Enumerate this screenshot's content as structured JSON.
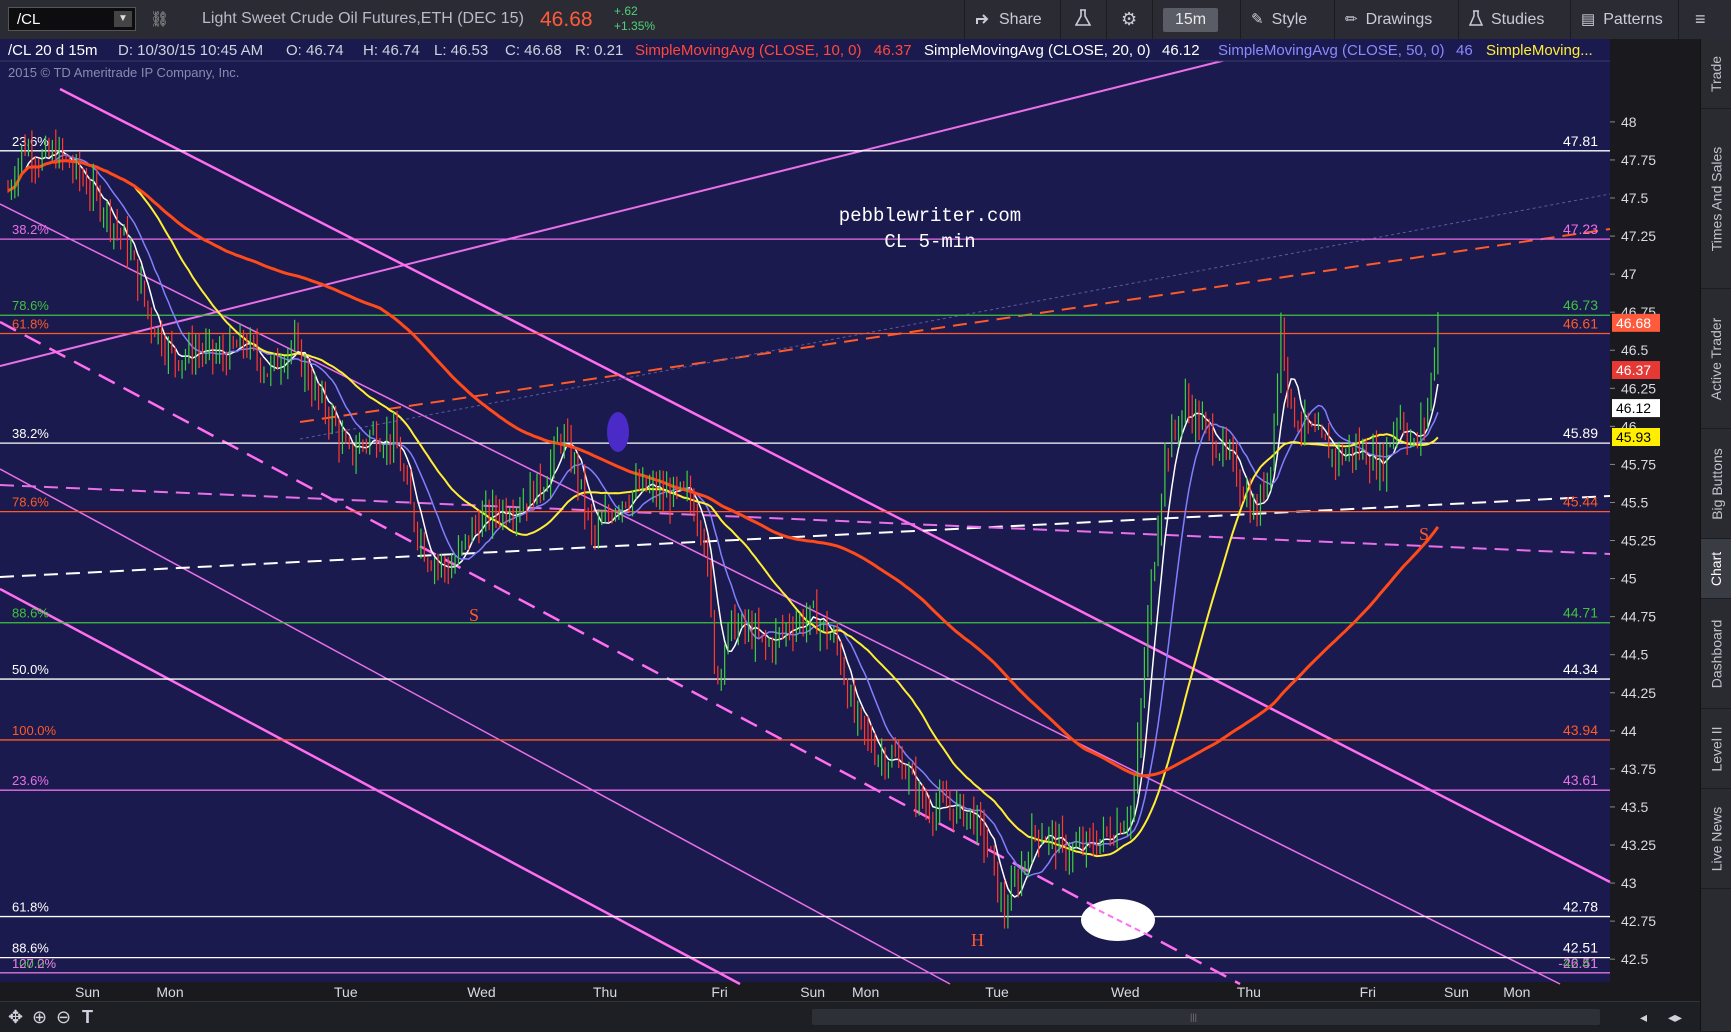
{
  "toolbar": {
    "symbol": "/CL",
    "dropdown_glyph": "▼",
    "link_glyph": "⛓",
    "description": "Light Sweet Crude Oil Futures,ETH (DEC 15)",
    "last_price": "46.68",
    "change": "+.62",
    "change_pct": "+1.35%",
    "share": "Share",
    "timeframe": "15m",
    "style": "Style",
    "drawings": "Drawings",
    "studies": "Studies",
    "patterns": "Patterns",
    "icons": {
      "share": "share-icon",
      "flask": "flask-icon",
      "gear": "gear-icon",
      "menu": "menu-icon"
    }
  },
  "header": {
    "symbol_info": "/CL 20 d 15m",
    "date": "D: 10/30/15 10:45 AM",
    "open": "O: 46.74",
    "high": "H: 46.74",
    "low": "L: 46.53",
    "close": "C: 46.68",
    "range": "R: 0.21",
    "sma10_label": "SimpleMovingAvg (CLOSE, 10, 0)",
    "sma10_value": "46.37",
    "sma20_label": "SimpleMovingAvg (CLOSE, 20, 0)",
    "sma20_value": "46.12",
    "sma50_label": "SimpleMovingAvg (CLOSE, 50, 0)",
    "sma50_value": "46",
    "sma_more": "SimpleMoving...",
    "copyright": "2015 © TD Ameritrade IP Company, Inc."
  },
  "watermark": {
    "line1": "pebblewriter.com",
    "line2": "CL 5-min"
  },
  "chart_data": {
    "type": "candlestick",
    "symbol": "/CL",
    "aggregation": "15m",
    "y_axis_ticks": [
      48,
      47.75,
      47.5,
      47.25,
      47,
      46.75,
      46.5,
      46.25,
      46,
      45.75,
      45.5,
      45.25,
      45,
      44.75,
      44.5,
      44.25,
      44,
      43.75,
      43.5,
      43.25,
      43,
      42.75,
      42.5
    ],
    "ylim": [
      42.35,
      48.4
    ],
    "x_axis_labels": [
      "Sun",
      "Mon",
      "Tue",
      "Wed",
      "Thu",
      "Fri",
      "Sun",
      "Mon",
      "Tue",
      "Wed",
      "Thu",
      "Fri",
      "Sun",
      "Mon"
    ],
    "x_axis_label_positions": [
      0.0,
      0.055,
      0.175,
      0.265,
      0.35,
      0.43,
      0.49,
      0.525,
      0.615,
      0.7,
      0.785,
      0.868,
      0.925,
      0.965
    ],
    "fib_levels": [
      {
        "left": "23.6%",
        "right": "47.81",
        "color": "#ffffff"
      },
      {
        "left": "38.2%",
        "right": "47.23",
        "color": "#e870e8"
      },
      {
        "left": "78.6%",
        "right": "46.73",
        "color": "#3ec43e"
      },
      {
        "left": "61.8%",
        "right": "46.61",
        "color": "#ff5a28"
      },
      {
        "left": "38.2%",
        "right": "45.89",
        "color": "#ffffff"
      },
      {
        "left": "78.6%",
        "right": "45.44",
        "color": "#ff5a28"
      },
      {
        "left": "88.6%",
        "right": "44.71",
        "color": "#3ec43e"
      },
      {
        "left": "50.0%",
        "right": "44.34",
        "color": "#ffffff"
      },
      {
        "left": "100.0%",
        "right": "43.94",
        "color": "#ff5a28"
      },
      {
        "left": "23.6%",
        "right": "43.61",
        "color": "#e870e8"
      },
      {
        "left": "61.8%",
        "right": "42.78",
        "color": "#ffffff"
      },
      {
        "left": "88.6%",
        "right": "42.51",
        "color": "#ffffff"
      },
      {
        "left": "100.0%",
        "right": "42.41",
        "color": "#3ec43e"
      },
      {
        "left": "127.2%",
        "right": "-26.51",
        "color": "#e870e8"
      }
    ],
    "price_badges": [
      {
        "value": "46.68",
        "bg": "#ff5a3c",
        "fg": "#ffffff"
      },
      {
        "value": "46.37",
        "bg": "#e53935",
        "fg": "#ffffff"
      },
      {
        "value": "46.12",
        "bg": "#ffffff",
        "fg": "#000000"
      },
      {
        "value": "45.93",
        "bg": "#ffee00",
        "fg": "#000000"
      }
    ],
    "pattern_labels": [
      {
        "text": "S",
        "color": "#ff5a28"
      },
      {
        "text": "H",
        "color": "#ff5a28"
      },
      {
        "text": "S",
        "color": "#ff5a28"
      }
    ],
    "series": [
      {
        "name": "SMA 10",
        "color": "#ffffff"
      },
      {
        "name": "SMA 20",
        "color": "#8080ff"
      },
      {
        "name": "SMA 50",
        "color": "#ffee33"
      },
      {
        "name": "SMA 200",
        "color": "#ff4a1a"
      }
    ],
    "close_path": [
      [
        0.0,
        47.55
      ],
      [
        0.01,
        47.85
      ],
      [
        0.02,
        47.75
      ],
      [
        0.03,
        47.8
      ],
      [
        0.045,
        47.65
      ],
      [
        0.06,
        47.45
      ],
      [
        0.075,
        47.2
      ],
      [
        0.09,
        46.7
      ],
      [
        0.105,
        46.45
      ],
      [
        0.12,
        46.5
      ],
      [
        0.135,
        46.45
      ],
      [
        0.15,
        46.55
      ],
      [
        0.165,
        46.35
      ],
      [
        0.18,
        46.55
      ],
      [
        0.195,
        46.2
      ],
      [
        0.205,
        46.05
      ],
      [
        0.215,
        45.8
      ],
      [
        0.23,
        45.95
      ],
      [
        0.245,
        45.9
      ],
      [
        0.255,
        45.45
      ],
      [
        0.265,
        45.15
      ],
      [
        0.28,
        45.05
      ],
      [
        0.295,
        45.35
      ],
      [
        0.31,
        45.45
      ],
      [
        0.325,
        45.5
      ],
      [
        0.34,
        45.65
      ],
      [
        0.35,
        45.95
      ],
      [
        0.36,
        45.7
      ],
      [
        0.37,
        45.25
      ],
      [
        0.385,
        45.5
      ],
      [
        0.4,
        45.6
      ],
      [
        0.415,
        45.55
      ],
      [
        0.43,
        45.55
      ],
      [
        0.44,
        45.35
      ],
      [
        0.448,
        44.35
      ],
      [
        0.458,
        44.7
      ],
      [
        0.47,
        44.65
      ],
      [
        0.48,
        44.55
      ],
      [
        0.495,
        44.7
      ],
      [
        0.51,
        44.75
      ],
      [
        0.525,
        44.55
      ],
      [
        0.535,
        44.1
      ],
      [
        0.55,
        43.85
      ],
      [
        0.565,
        43.8
      ],
      [
        0.58,
        43.5
      ],
      [
        0.595,
        43.5
      ],
      [
        0.61,
        43.45
      ],
      [
        0.62,
        43.25
      ],
      [
        0.63,
        42.8
      ],
      [
        0.64,
        43.05
      ],
      [
        0.65,
        43.35
      ],
      [
        0.66,
        43.3
      ],
      [
        0.67,
        43.2
      ],
      [
        0.685,
        43.25
      ],
      [
        0.7,
        43.35
      ],
      [
        0.712,
        43.5
      ],
      [
        0.722,
        44.8
      ],
      [
        0.732,
        45.8
      ],
      [
        0.745,
        46.15
      ],
      [
        0.76,
        45.95
      ],
      [
        0.775,
        45.75
      ],
      [
        0.79,
        45.4
      ],
      [
        0.8,
        45.85
      ],
      [
        0.806,
        46.7
      ],
      [
        0.812,
        46.1
      ],
      [
        0.825,
        45.95
      ],
      [
        0.84,
        45.8
      ],
      [
        0.855,
        45.85
      ],
      [
        0.87,
        45.75
      ],
      [
        0.88,
        46.1
      ],
      [
        0.89,
        45.85
      ],
      [
        0.898,
        46.1
      ],
      [
        0.905,
        46.68
      ]
    ]
  },
  "sidebar_tabs": [
    "Trade",
    "Times And Sales",
    "Active Trader",
    "Big Buttons",
    "Chart",
    "Dashboard",
    "Level II",
    "Live News"
  ],
  "bottom": {
    "scroll_grip": "|||"
  }
}
